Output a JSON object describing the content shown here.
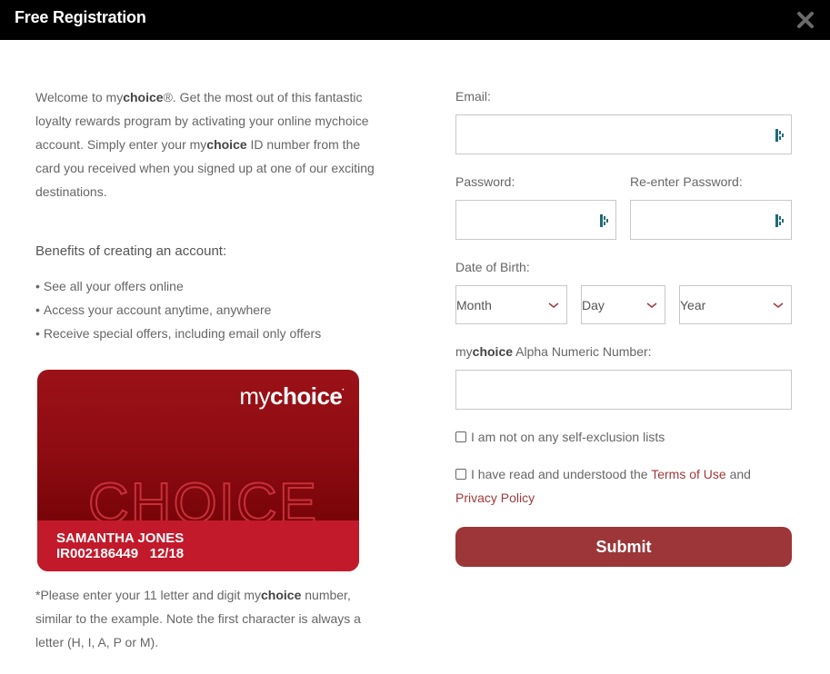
{
  "window": {
    "title": "Free Registration",
    "close_icon": "close-icon"
  },
  "left": {
    "intro": {
      "p1": "Welcome to my",
      "brand_bold": "choice",
      "p2": "®. Get the most out of this fantastic loyalty rewards program by activating your online mychoice account. Simply enter your my",
      "brand_bold2": "choice",
      "p3": " ID number from the card you received when you signed up at one of our exciting destinations."
    },
    "benefits_title": "Benefits of creating an account:",
    "benefits": [
      "See all your offers online",
      "Access your account anytime, anywhere",
      "Receive special offers, including email only offers"
    ],
    "bullet": "•",
    "card": {
      "logo_light": "my",
      "logo_bold": "choice",
      "big_word": "CHOICE",
      "holder_name": "SAMANTHA JONES",
      "card_id": "IR002186449",
      "expiry": "12/18",
      "colors": {
        "top": "#9b1218",
        "band": "#c21a2b"
      }
    },
    "note": {
      "p1": "*Please enter your 11 letter and digit my",
      "brand_bold": "choice",
      "p2": " number, similar to the example. Note the first character is always a letter (H, I, A, P or M)."
    }
  },
  "form": {
    "email": {
      "label": "Email:",
      "value": "",
      "placeholder": ""
    },
    "password": {
      "label": "Password:",
      "value": ""
    },
    "reenter_password": {
      "label": "Re-enter Password:",
      "value": ""
    },
    "dob": {
      "label": "Date of Birth:",
      "month": "Month",
      "day": "Day",
      "year": "Year"
    },
    "number": {
      "label_bold_prefix": "my",
      "label_bold": "choice",
      "label_rest": " Alpha Numeric Number:",
      "value": ""
    },
    "self_exclusion": {
      "label": "I am not on any self-exclusion lists",
      "checked": false
    },
    "terms": {
      "prefix": "I have read and understood the ",
      "terms_link": "Terms of Use",
      "middle": " and",
      "privacy_link": "Privacy Policy",
      "checked": false
    },
    "submit_label": "Submit"
  },
  "colors": {
    "accent": "#9c3638",
    "link": "#a0393c",
    "titlebar": "#000000",
    "pw_manager_icon": "#1f6b73"
  }
}
